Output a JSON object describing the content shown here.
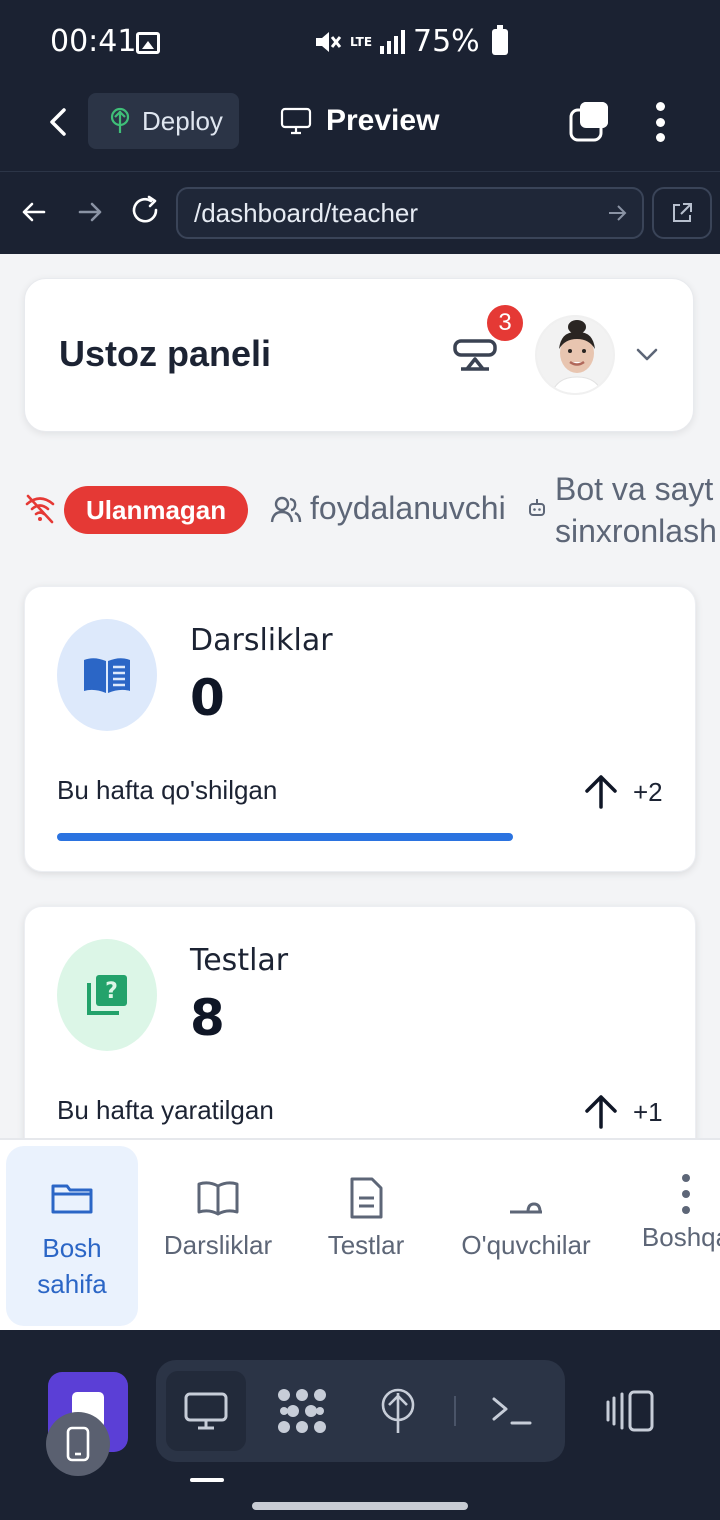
{
  "status_bar": {
    "time": "00:41",
    "network": "LTE",
    "battery": "75%"
  },
  "toolbar": {
    "deploy_label": "Deploy",
    "preview_label": "Preview"
  },
  "browser": {
    "url": "/dashboard/teacher"
  },
  "header": {
    "title": "Ustoz paneli",
    "notification_count": "3"
  },
  "status_row": {
    "connection_status": "Ulanmagan",
    "users_label": "foydalanuvchi",
    "sync_line1": "Bot va sayt",
    "sync_line2": "sinxronlash"
  },
  "stats": [
    {
      "label": "Darsliklar",
      "value": "0",
      "sub": "Bu hafta qo'shilgan",
      "delta": "+2",
      "icon": "book-icon",
      "color": "#2b66c6",
      "bg": "#dde9fb"
    },
    {
      "label": "Testlar",
      "value": "8",
      "sub": "Bu hafta yaratilgan",
      "delta": "+1",
      "icon": "quiz-icon",
      "color": "#23a26b",
      "bg": "#dcf6e7"
    }
  ],
  "bottom_nav": {
    "items": [
      {
        "label": "Bosh sahifa",
        "icon": "folder-icon",
        "active": true
      },
      {
        "label": "Darsliklar",
        "icon": "book-open-icon"
      },
      {
        "label": "Testlar",
        "icon": "document-icon"
      },
      {
        "label": "O'quvchilar",
        "icon": "students-icon"
      },
      {
        "label": "Boshqa",
        "icon": "more-icon"
      }
    ]
  },
  "colors": {
    "dark_bg": "#1b2232",
    "accent_blue": "#2b73e0",
    "danger": "#e53935"
  }
}
